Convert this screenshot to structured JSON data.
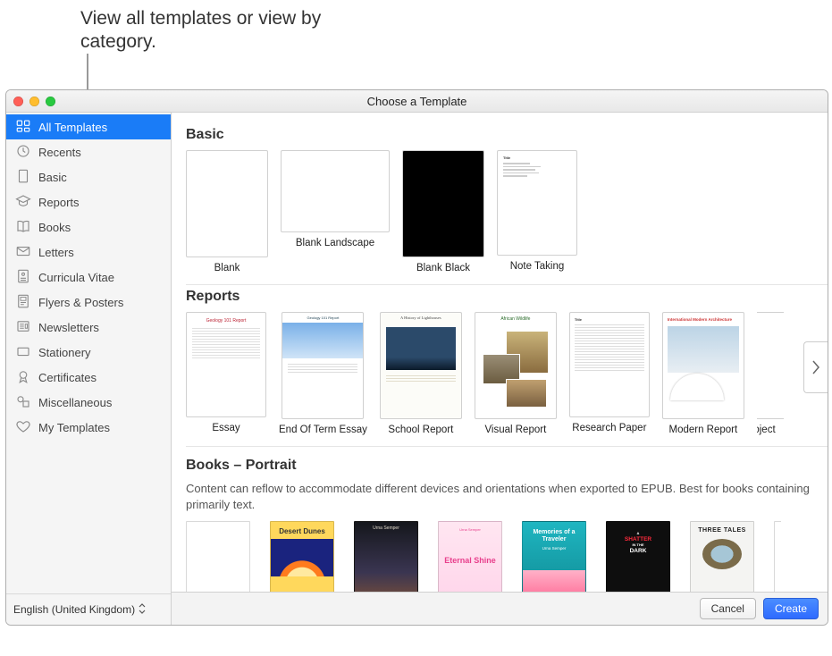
{
  "annotation": "View all templates or view by category.",
  "window_title": "Choose a Template",
  "sidebar": {
    "items": [
      {
        "icon": "grid-icon",
        "label": "All Templates"
      },
      {
        "icon": "clock-icon",
        "label": "Recents"
      },
      {
        "icon": "doc-icon",
        "label": "Basic"
      },
      {
        "icon": "gradcap-icon",
        "label": "Reports"
      },
      {
        "icon": "book-icon",
        "label": "Books"
      },
      {
        "icon": "envelope-icon",
        "label": "Letters"
      },
      {
        "icon": "cv-icon",
        "label": "Curricula Vitae"
      },
      {
        "icon": "flyer-icon",
        "label": "Flyers & Posters"
      },
      {
        "icon": "newspaper-icon",
        "label": "Newsletters"
      },
      {
        "icon": "card-icon",
        "label": "Stationery"
      },
      {
        "icon": "seal-icon",
        "label": "Certificates"
      },
      {
        "icon": "shapes-icon",
        "label": "Miscellaneous"
      },
      {
        "icon": "heart-icon",
        "label": "My Templates"
      }
    ],
    "selected_index": 0
  },
  "language": "English (United Kingdom)",
  "sections": {
    "basic": {
      "title": "Basic",
      "items": [
        "Blank",
        "Blank Landscape",
        "Blank Black",
        "Note Taking"
      ]
    },
    "reports": {
      "title": "Reports",
      "items": [
        "Essay",
        "End Of Term Essay",
        "School Report",
        "Visual Report",
        "Research Paper",
        "Modern Report",
        "Project"
      ]
    },
    "books": {
      "title": "Books – Portrait",
      "desc": "Content can reflow to accommodate different devices and orientations when exported to EPUB. Best for books containing primarily text.",
      "covers": [
        {
          "title": "Desert Dunes"
        },
        {
          "title": ""
        },
        {
          "title": "Urna Semper"
        },
        {
          "title": "Eternal Shine",
          "pre": "Urna Semper"
        },
        {
          "title": "Memories of a Traveler",
          "sub": "Urna Semper"
        },
        {
          "title": "A SHATTER IN THE DARK"
        },
        {
          "title": "THREE TALES"
        }
      ]
    }
  },
  "report_cards": {
    "essay_title": "Geology 101 Report",
    "geology_title": "Geology 101 Report",
    "lighthouse_title": "A History of Lighthouses",
    "wildlife_title": "African Wildlife",
    "modern_title": "International Modern Architecture"
  },
  "buttons": {
    "cancel": "Cancel",
    "create": "Create"
  }
}
